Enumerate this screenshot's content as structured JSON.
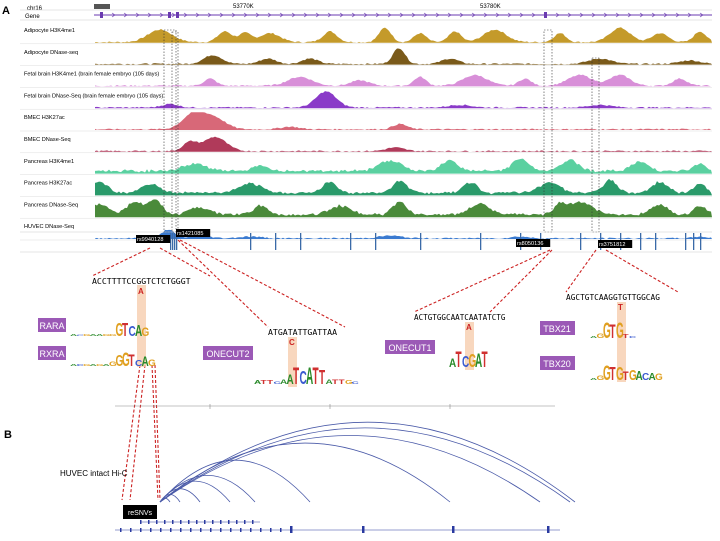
{
  "panels": {
    "a": "A",
    "b": "B"
  },
  "browser": {
    "chrom": "chr16",
    "gene_label": "Gene",
    "coord_ticks": [
      "53770K",
      "53780K"
    ]
  },
  "tracks": [
    {
      "label": "Adipocyte H3K4me1",
      "color": "#c49a2a"
    },
    {
      "label": "Adipocyte DNase-seq",
      "color": "#7a5a1a"
    },
    {
      "label": "Fetal brain H3K4me1 (brain female embryo (105 days)",
      "color": "#d88fd8"
    },
    {
      "label": "Fetal brain DNase-Seq (brain female embryo (105 days)",
      "color": "#8a3ac8"
    },
    {
      "label": "BMEC H3K27ac",
      "color": "#d86878"
    },
    {
      "label": "BMEC DNase-Seq",
      "color": "#b03a5a"
    },
    {
      "label": "Pancreas H3K4me1",
      "color": "#5ad0a0"
    },
    {
      "label": "Pancreas H3K27ac",
      "color": "#2a9a6a"
    },
    {
      "label": "Pancreas DNase-Seq",
      "color": "#4a8a3a"
    },
    {
      "label": "HUVEC DNase-Seq",
      "color": "#3a7ad0"
    }
  ],
  "snps": [
    "rs9940128",
    "rs1421085",
    "rs8050136",
    "rs3751812"
  ],
  "sequences": {
    "s1": "ACCTTTTCCGGTCTCTGGGT",
    "s2": "ATGATATTGATTAA",
    "s3": "ACTGTGGCAATCAATATCTG",
    "s4": "AGCTGTCAAGGTGTTGGCAG"
  },
  "alleles": {
    "s1": "A",
    "s2": "C",
    "s3": "A",
    "s4": "T"
  },
  "tfs": {
    "rara": "RARA",
    "rxra": "RXRA",
    "onecut2": "ONECUT2",
    "onecut1": "ONECUT1",
    "tbx21": "TBX21",
    "tbx20": "TBX20"
  },
  "hic": {
    "label": "HUVEC intact Hi-C",
    "badge": "reSNVs"
  },
  "colors": {
    "tf_badge": "#9b59b6",
    "connector": "#cc2222",
    "arc": "#4a5aa8",
    "gene": "#2a3aa0"
  }
}
